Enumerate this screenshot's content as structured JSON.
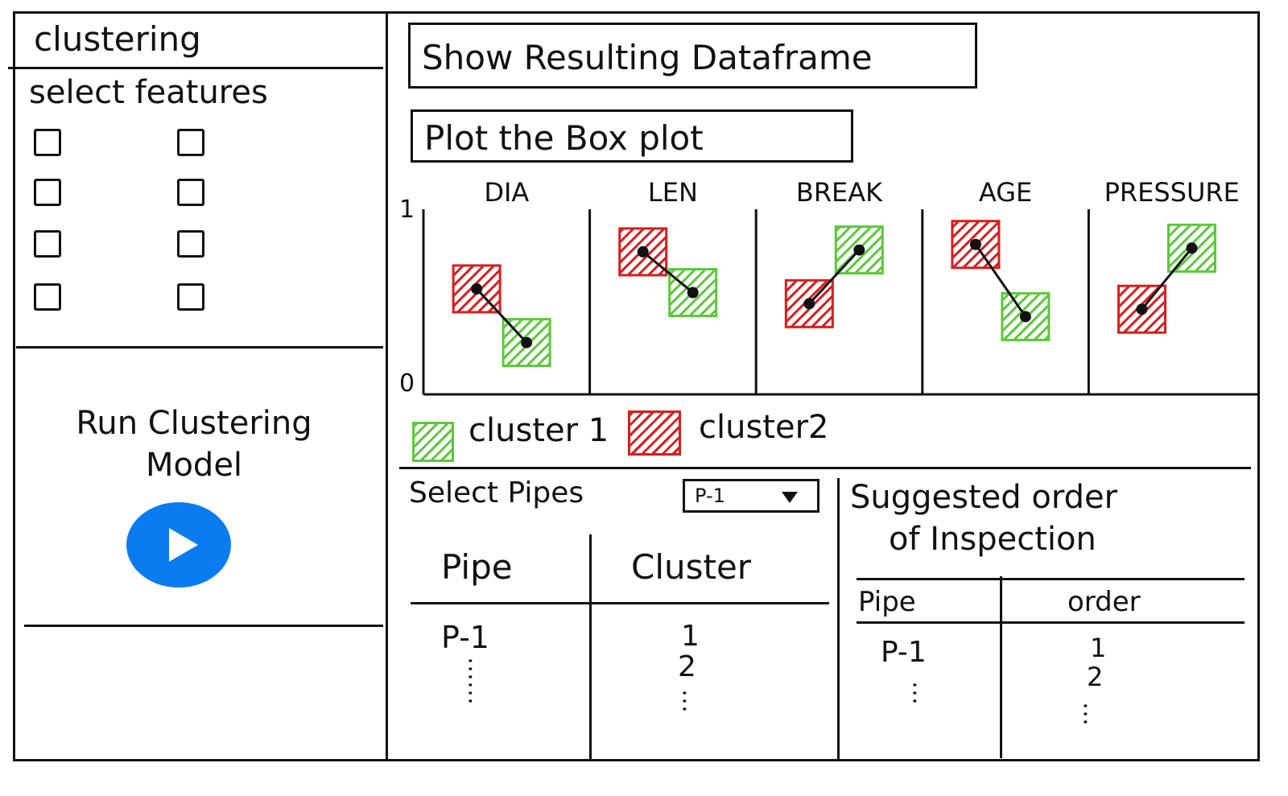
{
  "sidebar": {
    "title": "clustering",
    "features_label": "select features",
    "run_label_line1": "Run Clustering",
    "run_label_line2": "Model"
  },
  "main": {
    "show_df_label": "Show Resulting Dataframe",
    "plot_box_label": "Plot the Box plot",
    "legend": [
      {
        "label": "cluster 1",
        "color": "#5cc83a"
      },
      {
        "label": "cluster2",
        "color": "#d81e1e"
      }
    ],
    "select_pipes_label": "Select Pipes",
    "pipe_dropdown_value": "P-1",
    "pipe_table": {
      "headers": [
        "Pipe",
        "Cluster"
      ],
      "rows": [
        [
          "P-1",
          "1"
        ],
        [
          "",
          "2"
        ]
      ]
    },
    "suggested_title_line1": "Suggested order",
    "suggested_title_line2": "of Inspection",
    "order_table": {
      "headers": [
        "Pipe",
        "order"
      ],
      "rows": [
        [
          "P-1",
          "1"
        ],
        [
          "",
          "2"
        ]
      ]
    }
  },
  "colors": {
    "cluster1": "#5cc83a",
    "cluster2": "#d81e1e",
    "play_button": "#0a7cf0"
  },
  "icons": {
    "play": "play-icon",
    "dropdown": "chevron-down-icon"
  },
  "chart_data": {
    "type": "box",
    "title": "",
    "xlabel": "",
    "ylabel": "",
    "ylim": [
      0,
      1
    ],
    "y_tick_labels": [
      "0",
      "1"
    ],
    "categories": [
      "DIA",
      "LEN",
      "BREAK",
      "AGE",
      "PRESSURE"
    ],
    "series": [
      {
        "name": "cluster 1",
        "color": "#5cc83a",
        "values": [
          0.28,
          0.55,
          0.78,
          0.42,
          0.79
        ]
      },
      {
        "name": "cluster2",
        "color": "#d81e1e",
        "values": [
          0.57,
          0.77,
          0.49,
          0.81,
          0.46
        ]
      }
    ]
  }
}
